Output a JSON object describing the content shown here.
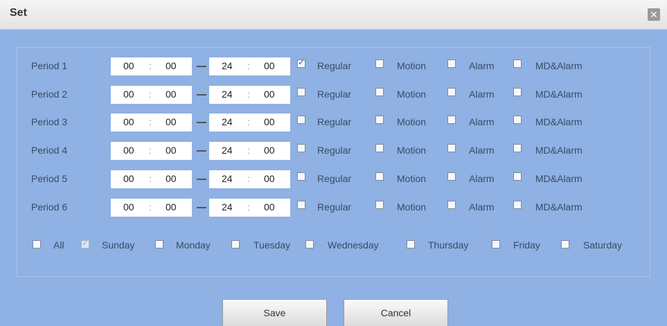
{
  "dialog": {
    "title": "Set"
  },
  "periods": [
    {
      "label": "Period 1",
      "start_h": "00",
      "start_m": "00",
      "end_h": "24",
      "end_m": "00",
      "regular": true,
      "motion": false,
      "alarm": false,
      "mdalarm": false
    },
    {
      "label": "Period 2",
      "start_h": "00",
      "start_m": "00",
      "end_h": "24",
      "end_m": "00",
      "regular": false,
      "motion": false,
      "alarm": false,
      "mdalarm": false
    },
    {
      "label": "Period 3",
      "start_h": "00",
      "start_m": "00",
      "end_h": "24",
      "end_m": "00",
      "regular": false,
      "motion": false,
      "alarm": false,
      "mdalarm": false
    },
    {
      "label": "Period 4",
      "start_h": "00",
      "start_m": "00",
      "end_h": "24",
      "end_m": "00",
      "regular": false,
      "motion": false,
      "alarm": false,
      "mdalarm": false
    },
    {
      "label": "Period 5",
      "start_h": "00",
      "start_m": "00",
      "end_h": "24",
      "end_m": "00",
      "regular": false,
      "motion": false,
      "alarm": false,
      "mdalarm": false
    },
    {
      "label": "Period 6",
      "start_h": "00",
      "start_m": "00",
      "end_h": "24",
      "end_m": "00",
      "regular": false,
      "motion": false,
      "alarm": false,
      "mdalarm": false
    }
  ],
  "options": {
    "regular": "Regular",
    "motion": "Motion",
    "alarm": "Alarm",
    "mdalarm": "MD&Alarm",
    "time_sep": ":"
  },
  "days": [
    {
      "label": "All",
      "checked": false
    },
    {
      "label": "Sunday",
      "checked": true,
      "disabled": true
    },
    {
      "label": "Monday",
      "checked": false
    },
    {
      "label": "Tuesday",
      "checked": false
    },
    {
      "label": "Wednesday",
      "checked": false
    },
    {
      "label": "Thursday",
      "checked": false
    },
    {
      "label": "Friday",
      "checked": false
    },
    {
      "label": "Saturday",
      "checked": false
    }
  ],
  "buttons": {
    "save": "Save",
    "cancel": "Cancel"
  }
}
